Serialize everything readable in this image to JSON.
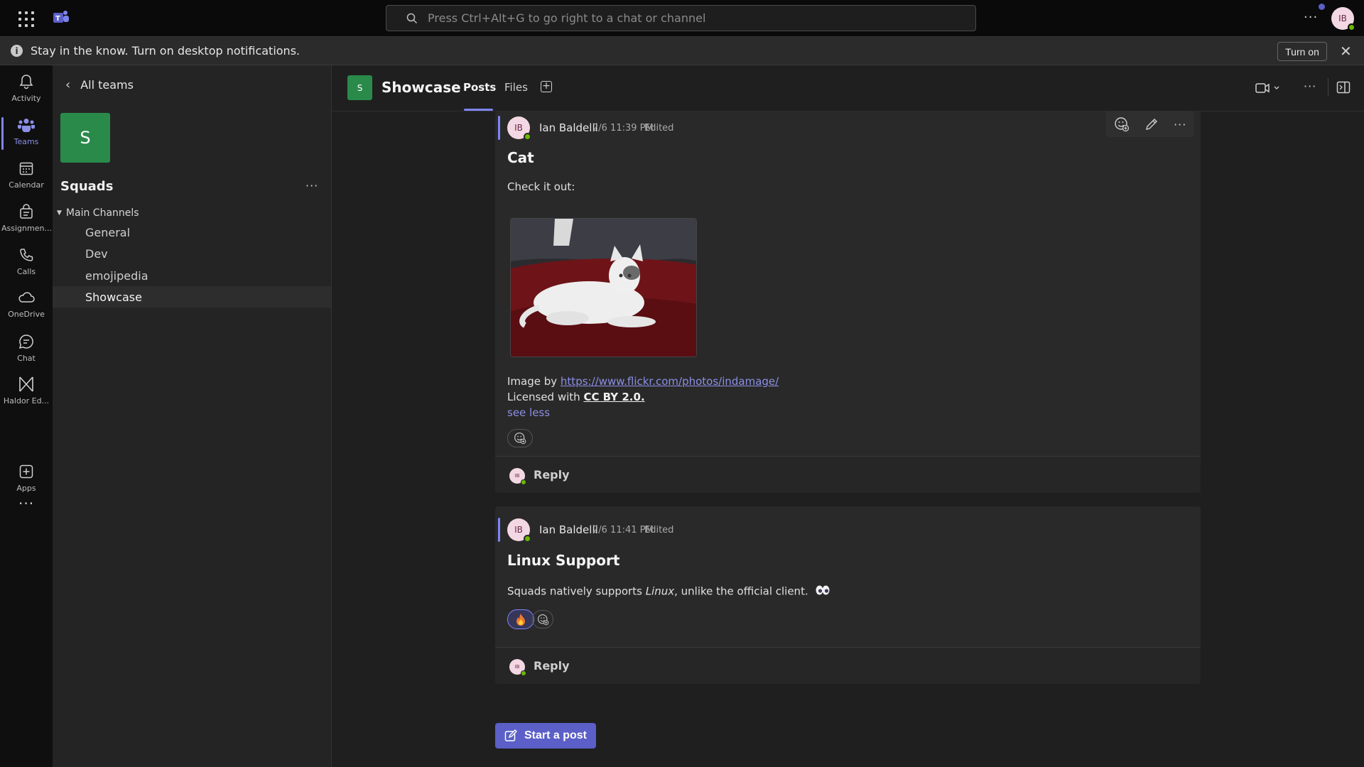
{
  "topbar": {
    "search_placeholder": "Press Ctrl+Alt+G to go right to a chat or channel",
    "avatar_initials": "IB"
  },
  "notification": {
    "message": "Stay in the know. Turn on desktop notifications.",
    "button_label": "Turn on"
  },
  "rail": {
    "items": [
      {
        "label": "Activity",
        "icon": "bell-icon"
      },
      {
        "label": "Teams",
        "icon": "teams-icon"
      },
      {
        "label": "Calendar",
        "icon": "calendar-icon"
      },
      {
        "label": "Assignmen...",
        "icon": "assignments-icon"
      },
      {
        "label": "Calls",
        "icon": "phone-icon"
      },
      {
        "label": "OneDrive",
        "icon": "cloud-icon"
      },
      {
        "label": "Chat",
        "icon": "chat-icon"
      },
      {
        "label": "Haldor Ed...",
        "icon": "haldor-icon"
      },
      {
        "label": "Apps",
        "icon": "add-app-icon"
      }
    ]
  },
  "sidebar": {
    "back_label": "All teams",
    "team_initial": "S",
    "team_name": "Squads",
    "section_label": "Main Channels",
    "channels": [
      "General",
      "Dev",
      "emojipedia",
      "Showcase"
    ],
    "active_channel": "Showcase"
  },
  "channel": {
    "initial": "S",
    "title": "Showcase",
    "tabs": [
      "Posts",
      "Files"
    ],
    "active_tab": "Posts"
  },
  "posts": [
    {
      "author_initials": "IB",
      "author": "Ian Baldelli",
      "timestamp": "2/6 11:39 PM",
      "edited": "Edited",
      "subject": "Cat",
      "body": "Check it out:",
      "credit_prefix": "Image by ",
      "credit_link": "https://www.flickr.com/photos/indamage/",
      "license_prefix": "Licensed with ",
      "license": "CC BY 2.0.",
      "see_less": "see less",
      "reply_label": "Reply"
    },
    {
      "author_initials": "IB",
      "author": "Ian Baldelli",
      "timestamp": "2/6 11:41 PM",
      "edited": "Edited",
      "subject": "Linux Support",
      "body_prefix": "Squads natively supports ",
      "body_em": "Linux",
      "body_suffix": ", unlike the official client.",
      "reply_label": "Reply"
    }
  ],
  "start_post_label": "Start a post",
  "colors": {
    "accent": "#7f85f5",
    "brand": "#5b5fc7",
    "team_tile": "#2a8a4a",
    "presence": "#6bb700"
  }
}
